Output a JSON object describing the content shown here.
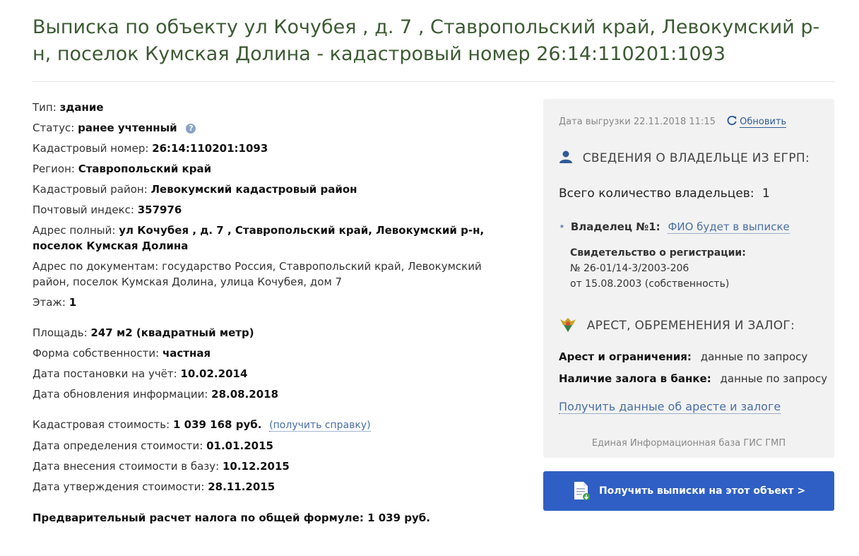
{
  "page": {
    "title": "Выписка по объекту ул Кочубея , д. 7 , Ставропольский край, Левокумский р-н, поселок Кумская Долина - кадастровый номер 26:14:110201:1093"
  },
  "info": {
    "type_label": "Тип:",
    "type_value": "здание",
    "status_label": "Статус:",
    "status_value": "ранее учтенный",
    "status_help": "?",
    "cadnum_label": "Кадастровый номер:",
    "cadnum_value": "26:14:110201:1093",
    "region_label": "Регион:",
    "region_value": "Ставропольский край",
    "district_label": "Кадастровый район:",
    "district_value": "Левокумский кадастровый район",
    "postal_label": "Почтовый индекс:",
    "postal_value": "357976",
    "addr_full_label": "Адрес полный:",
    "addr_full_value": "ул Кочубея , д. 7 , Ставропольский край, Левокумский р-н, поселок Кумская Долина",
    "addr_docs_label": "Адрес по документам:",
    "addr_docs_value": "государство Россия, Ставропольский край, Левокумский район, поселок Кумская Долина, улица Кочубея, дом 7",
    "floor_label": "Этаж:",
    "floor_value": "1",
    "area_label": "Площадь:",
    "area_value": "247 м2 (квадратный метр)",
    "ownership_label": "Форма собственности:",
    "ownership_value": "частная",
    "reg_date_label": "Дата постановки на учёт:",
    "reg_date_value": "10.02.2014",
    "upd_date_label": "Дата обновления информации:",
    "upd_date_value": "28.08.2018",
    "cost_label": "Кадастровая стоимость:",
    "cost_value": "1 039 168 руб.",
    "cost_link": "(получить справку)",
    "cost_def_label": "Дата определения стоимости:",
    "cost_def_value": "01.01.2015",
    "cost_entry_label": "Дата внесения стоимости в базу:",
    "cost_entry_value": "10.12.2015",
    "cost_appr_label": "Дата утверждения стоимости:",
    "cost_appr_value": "28.11.2015",
    "tax_label": "Предварительный расчет налога по общей формуле:",
    "tax_value": "1 039 руб."
  },
  "panel": {
    "export_text": "Дата выгрузки 22.11.2018 11:15",
    "refresh_label": "Обновить",
    "owners_heading": "СВЕДЕНИЯ О ВЛАДЕЛЬЦЕ ИЗ ЕГРП:",
    "owners_total_label": "Всего количество владельцев:",
    "owners_total_value": "1",
    "owner_label": "Владелец №1:",
    "owner_fio": "ФИО будет в выписке",
    "cert_title": "Свидетельство о регистрации:",
    "cert_number": "№ 26-01/14-3/2003-206",
    "cert_date": "от 15.08.2003 (собственность)",
    "arrest_heading": "АРЕСТ, ОБРЕМЕНЕНИЯ И ЗАЛОГ:",
    "arrest_label": "Арест и ограничения:",
    "arrest_value": "данные по запросу",
    "pledge_label": "Наличие залога в банке:",
    "pledge_value": "данные по запросу",
    "arrest_link": "Получить данные об аресте и залоге",
    "gis_note": "Единая Информационная база ГИС ГМП"
  },
  "cta": {
    "label": "Получить выписки на этот объект >"
  },
  "colors": {
    "title_green": "#3c5a33",
    "link_blue": "#4a6fa5",
    "button_blue": "#2f5fc4",
    "panel_bg": "#f2f2f2"
  }
}
